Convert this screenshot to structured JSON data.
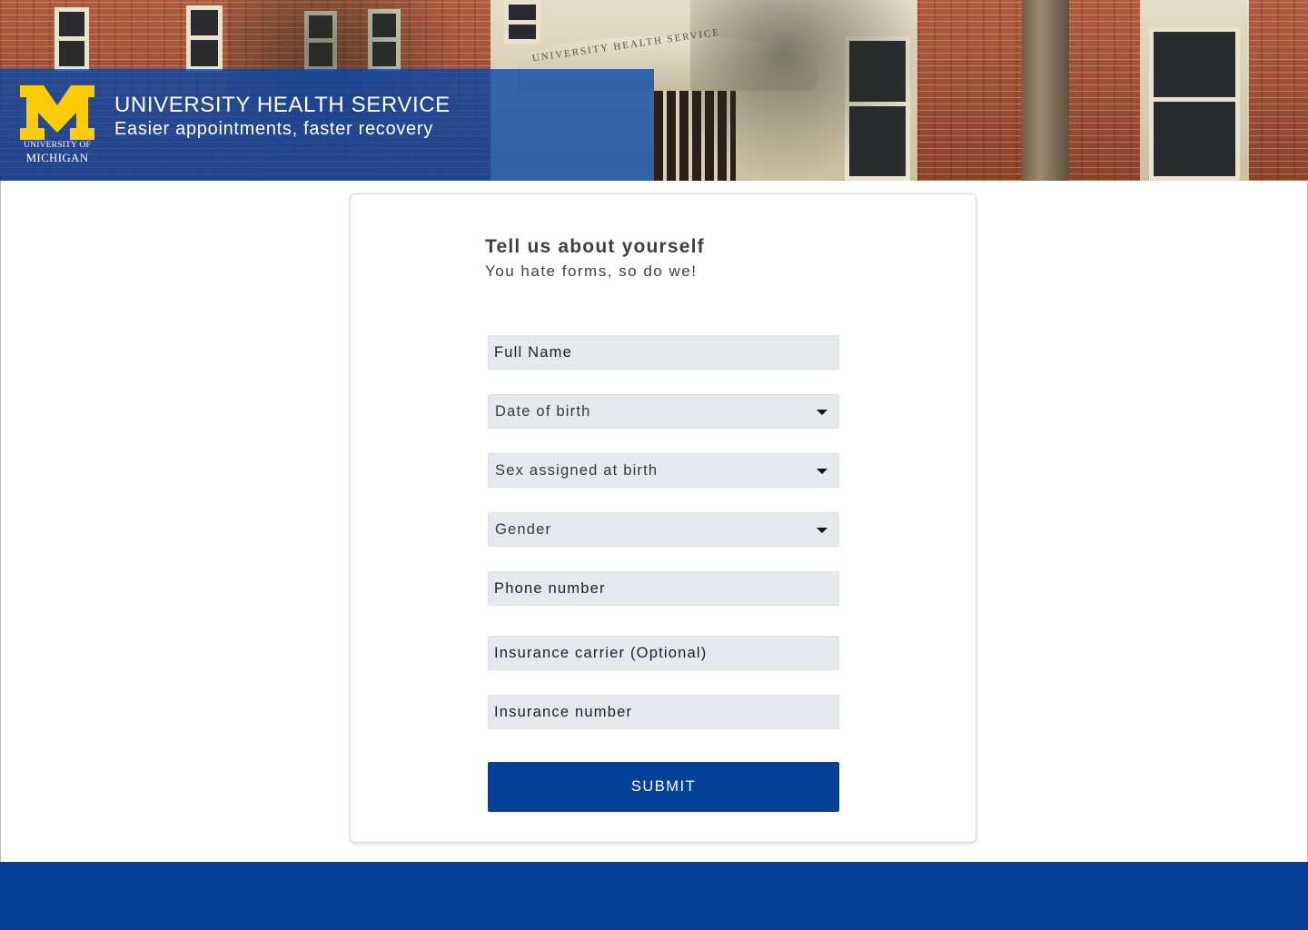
{
  "header": {
    "logo": {
      "name": "university-of-michigan-logo",
      "line1": "UNIVERSITY OF",
      "line2": "MICHIGAN",
      "color_maize": "#FFCB05"
    },
    "title": "UNIVERSITY HEALTH SERVICE",
    "subtitle": "Easier appointments, faster recovery",
    "banner_color": "#0646AA",
    "photo_sign": "UNIVERSITY HEALTH SERVICE"
  },
  "form": {
    "title": "Tell us about yourself",
    "subtitle": "You hate forms, so do we!",
    "fields": {
      "full_name": {
        "placeholder": "Full Name",
        "value": ""
      },
      "date_of_birth": {
        "label": "Date of birth",
        "icon": "chevron-down-icon"
      },
      "sex_at_birth": {
        "label": "Sex assigned at birth",
        "icon": "chevron-down-icon"
      },
      "gender": {
        "label": "Gender",
        "icon": "chevron-down-icon"
      },
      "phone": {
        "placeholder": "Phone number",
        "value": ""
      },
      "insurance_carrier": {
        "placeholder": "Insurance carrier (Optional)",
        "value": ""
      },
      "insurance_number": {
        "placeholder": "Insurance number",
        "value": ""
      }
    },
    "submit_label": "SUBMIT",
    "accent_color": "#034298",
    "field_bg": "#E5E8ED"
  },
  "footer": {
    "color": "#034298"
  }
}
